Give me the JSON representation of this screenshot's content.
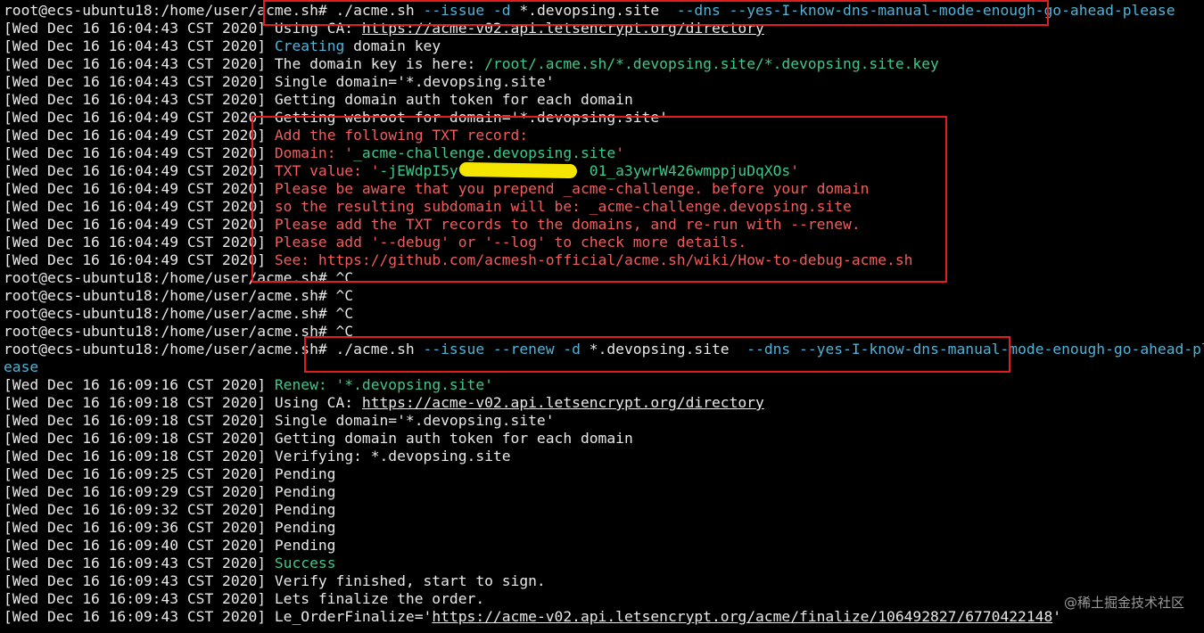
{
  "colors": {
    "background": "#000000",
    "default": "#e8e8e8",
    "cyan": "#4fb3d9",
    "green": "#3ec98b",
    "red": "#f25c5c",
    "highlight_box": "#e01e1e",
    "redaction": "#f5e600"
  },
  "watermark": "@稀土掘金技术社区",
  "lines": [
    [
      {
        "t": "root@ecs-ubuntu18:/home/user/acme.sh# ./acme.sh ",
        "c": "default"
      },
      {
        "t": "--issue -d",
        "c": "cyan"
      },
      {
        "t": " *.devopsing.site  ",
        "c": "default"
      },
      {
        "t": "--dns --yes-I-know-dns-manual-mode-enough-go-ahead-please",
        "c": "cyan"
      }
    ],
    [
      {
        "t": "[Wed Dec 16 16:04:43 CST 2020] Using CA: ",
        "c": "default"
      },
      {
        "t": "https://acme-v02.api.letsencrypt.org/directory",
        "c": "link"
      }
    ],
    [
      {
        "t": "[Wed Dec 16 16:04:43 CST 2020] ",
        "c": "default"
      },
      {
        "t": "Creating",
        "c": "cyan"
      },
      {
        "t": " domain key",
        "c": "default"
      }
    ],
    [
      {
        "t": "[Wed Dec 16 16:04:43 CST 2020] The domain key is here: ",
        "c": "default"
      },
      {
        "t": "/root/.acme.sh/*.devopsing.site/*.devopsing.site.key",
        "c": "green"
      }
    ],
    [
      {
        "t": "[Wed Dec 16 16:04:43 CST 2020] Single domain='*.devopsing.site'",
        "c": "default"
      }
    ],
    [
      {
        "t": "[Wed Dec 16 16:04:43 CST 2020] Getting domain auth token for each domain",
        "c": "default"
      }
    ],
    [
      {
        "t": "[Wed Dec 16 16:04:49 CST 2020] Getting webroot for domain='*.devopsing.site'",
        "c": "default"
      }
    ],
    [
      {
        "t": "[Wed Dec 16 16:04:49 CST 2020] ",
        "c": "default"
      },
      {
        "t": "Add the following TXT record:",
        "c": "red"
      }
    ],
    [
      {
        "t": "[Wed Dec 16 16:04:49 CST 2020] ",
        "c": "default"
      },
      {
        "t": "Domain: '",
        "c": "red"
      },
      {
        "t": "_acme-challenge.devopsing.site",
        "c": "green"
      },
      {
        "t": "'",
        "c": "red"
      }
    ],
    [
      {
        "t": "[Wed Dec 16 16:04:49 CST 2020] ",
        "c": "default"
      },
      {
        "t": "TXT value: '",
        "c": "red"
      },
      {
        "t": "-jEWdpI5y               01_a3ywrW426wmppjuDqXOs",
        "c": "green"
      },
      {
        "t": "'",
        "c": "red"
      }
    ],
    [
      {
        "t": "[Wed Dec 16 16:04:49 CST 2020] ",
        "c": "default"
      },
      {
        "t": "Please be aware that you prepend _acme-challenge. before your domain",
        "c": "red"
      }
    ],
    [
      {
        "t": "[Wed Dec 16 16:04:49 CST 2020] ",
        "c": "default"
      },
      {
        "t": "so the resulting subdomain will be: _acme-challenge.devopsing.site",
        "c": "red"
      }
    ],
    [
      {
        "t": "[Wed Dec 16 16:04:49 CST 2020] ",
        "c": "default"
      },
      {
        "t": "Please add the TXT records to the domains, and re-run with --renew.",
        "c": "red"
      }
    ],
    [
      {
        "t": "[Wed Dec 16 16:04:49 CST 2020] ",
        "c": "default"
      },
      {
        "t": "Please add '--debug' or '--log' to check more details.",
        "c": "red"
      }
    ],
    [
      {
        "t": "[Wed Dec 16 16:04:49 CST 2020] ",
        "c": "default"
      },
      {
        "t": "See: https://github.com/acmesh-official/acme.sh/wiki/How-to-debug-acme.sh",
        "c": "red"
      }
    ],
    [
      {
        "t": "root@ecs-ubuntu18:/home/user/acme.sh# ^C",
        "c": "default"
      }
    ],
    [
      {
        "t": "root@ecs-ubuntu18:/home/user/acme.sh# ^C",
        "c": "default"
      }
    ],
    [
      {
        "t": "root@ecs-ubuntu18:/home/user/acme.sh# ^C",
        "c": "default"
      }
    ],
    [
      {
        "t": "root@ecs-ubuntu18:/home/user/acme.sh# ^C",
        "c": "default"
      }
    ],
    [
      {
        "t": "root@ecs-ubuntu18:/home/user/acme.sh# ./acme.sh ",
        "c": "default"
      },
      {
        "t": "--issue --renew -d",
        "c": "cyan"
      },
      {
        "t": " *.devopsing.site  ",
        "c": "default"
      },
      {
        "t": "--dns --yes-I-know-dns-manual-mode-enough-go-ahead-pl",
        "c": "cyan"
      }
    ],
    [
      {
        "t": "ease",
        "c": "cyan"
      }
    ],
    [
      {
        "t": "[Wed Dec 16 16:09:16 CST 2020] ",
        "c": "default"
      },
      {
        "t": "Renew: '*.devopsing.site'",
        "c": "green"
      }
    ],
    [
      {
        "t": "[Wed Dec 16 16:09:18 CST 2020] Using CA: ",
        "c": "default"
      },
      {
        "t": "https://acme-v02.api.letsencrypt.org/directory",
        "c": "link"
      }
    ],
    [
      {
        "t": "[Wed Dec 16 16:09:18 CST 2020] Single domain='*.devopsing.site'",
        "c": "default"
      }
    ],
    [
      {
        "t": "[Wed Dec 16 16:09:18 CST 2020] Getting domain auth token for each domain",
        "c": "default"
      }
    ],
    [
      {
        "t": "[Wed Dec 16 16:09:18 CST 2020] Verifying: *.devopsing.site",
        "c": "default"
      }
    ],
    [
      {
        "t": "[Wed Dec 16 16:09:25 CST 2020] Pending",
        "c": "default"
      }
    ],
    [
      {
        "t": "[Wed Dec 16 16:09:29 CST 2020] Pending",
        "c": "default"
      }
    ],
    [
      {
        "t": "[Wed Dec 16 16:09:32 CST 2020] Pending",
        "c": "default"
      }
    ],
    [
      {
        "t": "[Wed Dec 16 16:09:36 CST 2020] Pending",
        "c": "default"
      }
    ],
    [
      {
        "t": "[Wed Dec 16 16:09:40 CST 2020] Pending",
        "c": "default"
      }
    ],
    [
      {
        "t": "[Wed Dec 16 16:09:43 CST 2020] ",
        "c": "default"
      },
      {
        "t": "Success",
        "c": "green"
      }
    ],
    [
      {
        "t": "[Wed Dec 16 16:09:43 CST 2020] Verify finished, start to sign.",
        "c": "default"
      }
    ],
    [
      {
        "t": "[Wed Dec 16 16:09:43 CST 2020] Lets finalize the order.",
        "c": "default"
      }
    ],
    [
      {
        "t": "[Wed Dec 16 16:09:43 CST 2020] Le_OrderFinalize='",
        "c": "default"
      },
      {
        "t": "https://acme-v02.api.letsencrypt.org/acme/finalize/106492827/6770422148",
        "c": "link"
      },
      {
        "t": "'",
        "c": "default"
      }
    ]
  ]
}
